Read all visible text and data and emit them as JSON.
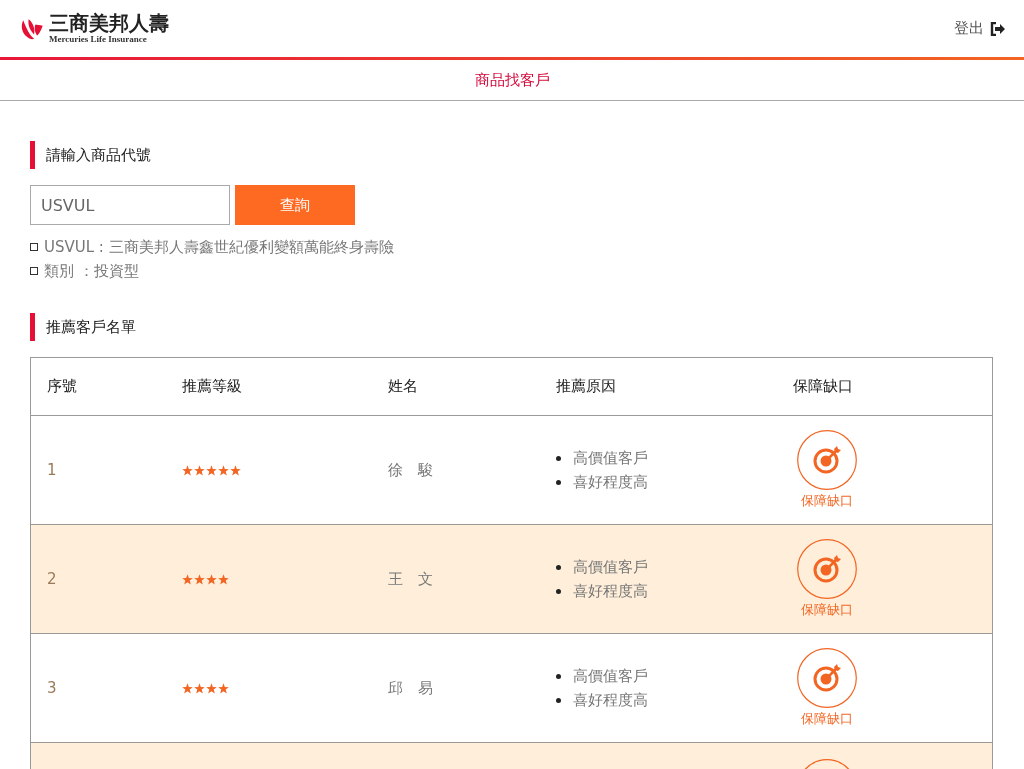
{
  "header": {
    "brand": "三商美邦人壽",
    "brand_subtitle": "Mercuries Life Insurance",
    "logout": "登出"
  },
  "page_title": "商品找客戶",
  "product_section": {
    "heading": "請輸入商品代號",
    "input_value": "USVUL",
    "search_button": "查詢",
    "info": [
      "USVUL : 三商美邦人壽鑫世紀優利變額萬能終身壽險",
      "類別 ：投資型"
    ]
  },
  "customer_section": {
    "heading": "推薦客戶名單",
    "table": {
      "columns": [
        "序號",
        "推薦等級",
        "姓名",
        "推薦原因",
        "保障缺口"
      ],
      "rows": [
        {
          "number": "1",
          "stars": 5,
          "name": "徐　駿",
          "reasons": [
            "高價值客戶",
            "喜好程度高"
          ],
          "gap_label": "保障缺口",
          "highlighted": false
        },
        {
          "number": "2",
          "stars": 4,
          "name": "王　文",
          "reasons": [
            "高價值客戶",
            "喜好程度高"
          ],
          "gap_label": "保障缺口",
          "highlighted": true
        },
        {
          "number": "3",
          "stars": 4,
          "name": "邱　易",
          "reasons": [
            "高價值客戶",
            "喜好程度高"
          ],
          "gap_label": "保障缺口",
          "highlighted": false
        },
        {
          "highlighted": true,
          "gap_icon_only": true
        }
      ]
    }
  }
}
